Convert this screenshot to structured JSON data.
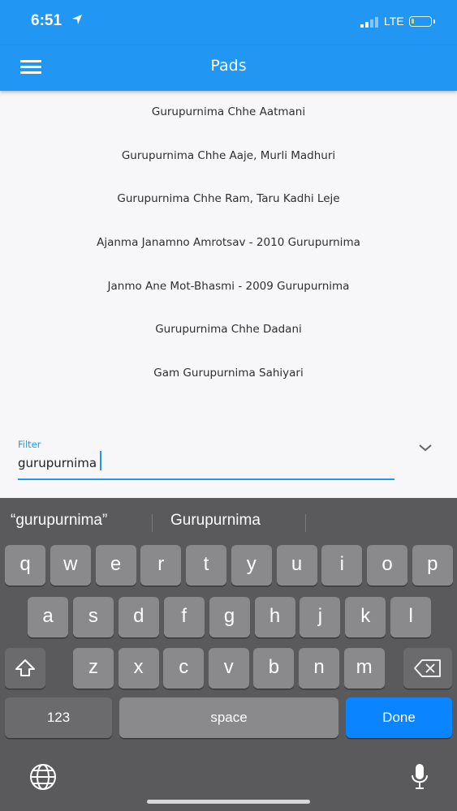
{
  "status": {
    "time": "6:51",
    "network": "LTE"
  },
  "app_bar": {
    "title": "Pads"
  },
  "list": [
    "Gurupurnima Chhe Aatmani",
    "Gurupurnima Chhe Aaje, Murli Madhuri",
    "Gurupurnima Chhe Ram, Taru Kadhi Leje",
    "Ajanma Janamno Amrotsav - 2010 Gurupurnima",
    "Janmo Ane Mot-Bhasmi - 2009 Gurupurnima",
    "Gurupurnima Chhe Dadani",
    "Gam Gurupurnima Sahiyari"
  ],
  "filter": {
    "label": "Filter",
    "value": "gurupurnima"
  },
  "keyboard": {
    "suggestions": [
      "“gurupurnima”",
      "Gurupurnima"
    ],
    "row1": [
      "q",
      "w",
      "e",
      "r",
      "t",
      "y",
      "u",
      "i",
      "o",
      "p"
    ],
    "row2": [
      "a",
      "s",
      "d",
      "f",
      "g",
      "h",
      "j",
      "k",
      "l"
    ],
    "row3": [
      "z",
      "x",
      "c",
      "v",
      "b",
      "n",
      "m"
    ],
    "numbers_label": "123",
    "space_label": "space",
    "done_label": "Done"
  },
  "colors": {
    "accent": "#2196f3",
    "done_button": "#0a84ff"
  }
}
